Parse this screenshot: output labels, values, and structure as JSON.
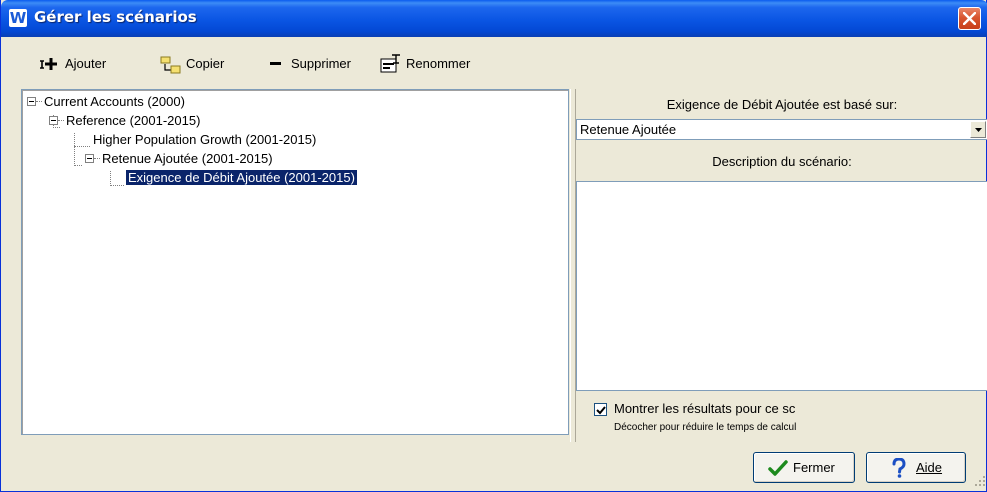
{
  "window": {
    "title": "Gérer les scénarios",
    "app_icon_letter": "W"
  },
  "toolbar": {
    "add_label": "Ajouter",
    "copy_label": "Copier",
    "delete_label": "Supprimer",
    "rename_label": "Renommer"
  },
  "tree": {
    "items": [
      {
        "label": "Current Accounts (2000)",
        "level": 0,
        "expanded": true
      },
      {
        "label": "Reference (2001-2015)",
        "level": 1,
        "expanded": true
      },
      {
        "label": "Higher Population Growth (2001-2015)",
        "level": 2
      },
      {
        "label": "Retenue Ajoutée (2001-2015)",
        "level": 2,
        "expanded": true
      },
      {
        "label": "Exigence de Débit Ajoutée (2001-2015)",
        "level": 3,
        "selected": true
      }
    ]
  },
  "details": {
    "based_on_label": "Exigence de Débit Ajoutée est basé sur:",
    "based_on_value": "Retenue Ajoutée",
    "description_label": "Description du scénario:",
    "description_value": "",
    "show_results_label": "Montrer les résultats pour ce sc",
    "show_results_checked": true,
    "hint": "Décocher pour réduire le temps de calcul"
  },
  "buttons": {
    "close_label": "Fermer",
    "help_label": "Aide"
  },
  "colors": {
    "titlebar": "#0a55e3",
    "selection": "#0a246a",
    "close_button": "#d8552f"
  }
}
